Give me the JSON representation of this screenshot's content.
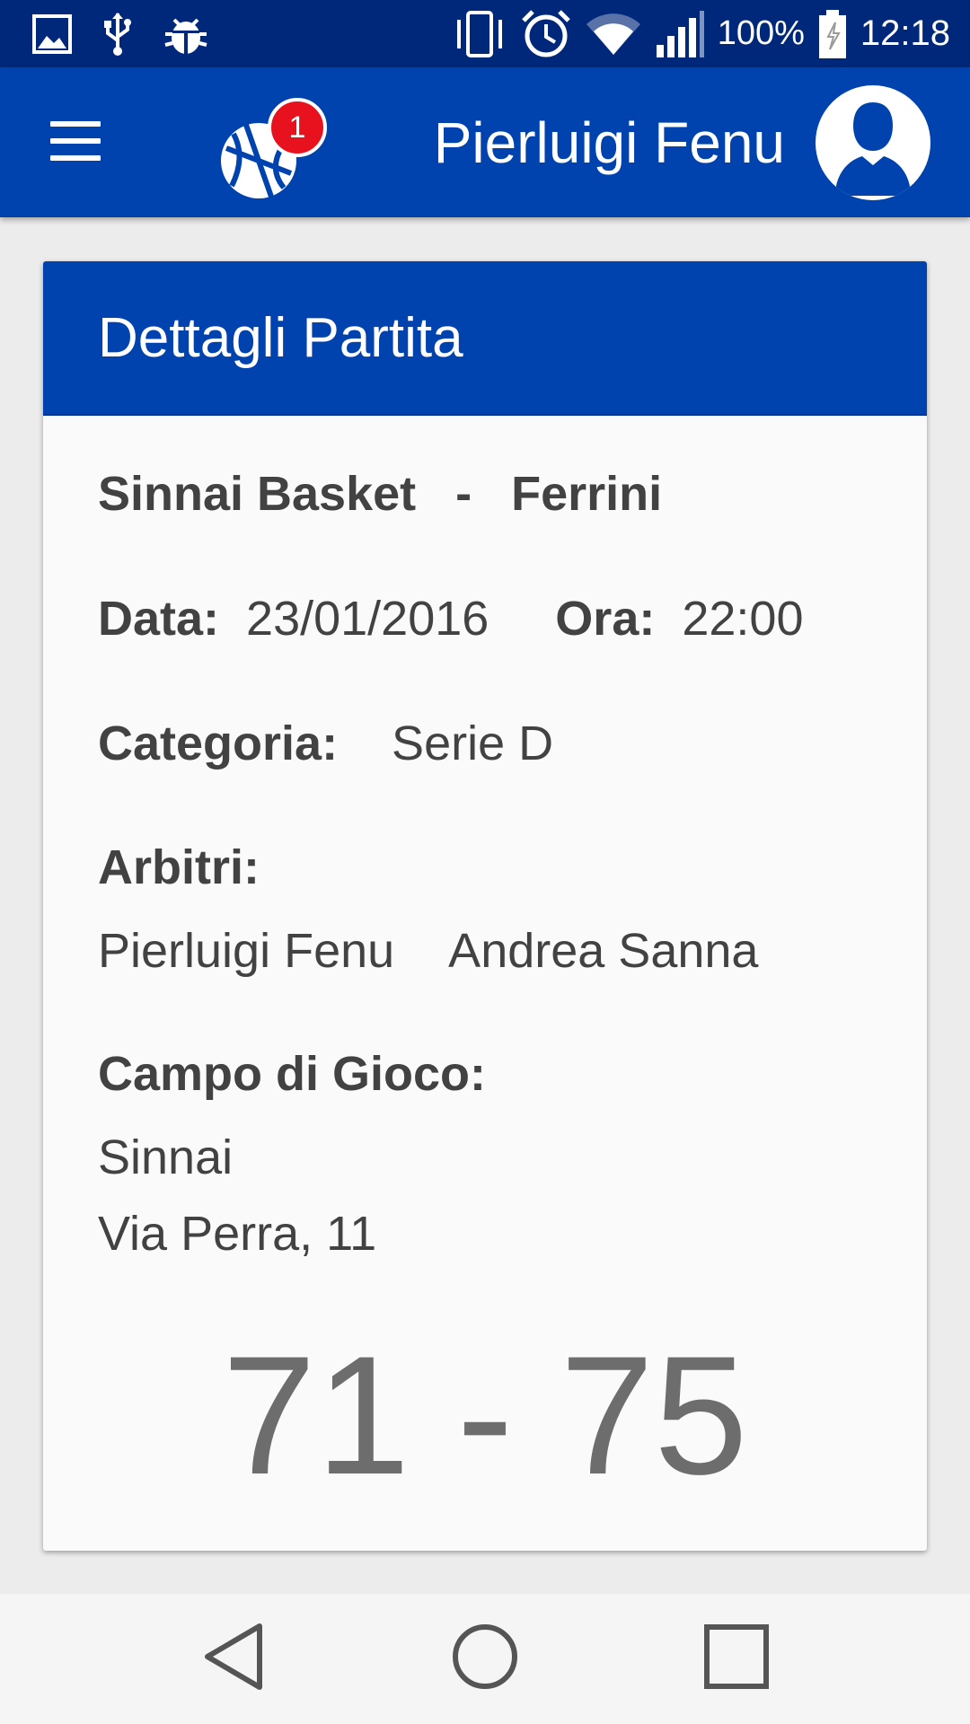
{
  "status_bar": {
    "battery_percent": "100%",
    "time": "12:18",
    "left_icons": [
      "image-icon",
      "usb-icon",
      "bug-icon"
    ],
    "right_icons": [
      "vibrate-icon",
      "alarm-icon",
      "wifi-icon",
      "signal-icon",
      "battery-icon"
    ]
  },
  "app_bar": {
    "user_name": "Pierluigi Fenu",
    "notification_count": "1",
    "color": "#0043ae"
  },
  "card": {
    "title": "Dettagli Partita",
    "home_team": "Sinnai Basket",
    "separator": "-",
    "away_team": "Ferrini",
    "date_label": "Data:",
    "date_value": "23/01/2016",
    "time_label": "Ora:",
    "time_value": "22:00",
    "category_label": "Categoria:",
    "category_value": "Serie D",
    "referees_label": "Arbitri:",
    "referees": [
      "Pierluigi Fenu",
      "Andrea Sanna"
    ],
    "venue_label": "Campo di Gioco:",
    "venue_city": "Sinnai",
    "venue_address": "Via Perra, 11",
    "score": "71 - 75"
  },
  "nav_bar": {
    "buttons": [
      "back-icon",
      "home-icon",
      "recents-icon"
    ]
  }
}
